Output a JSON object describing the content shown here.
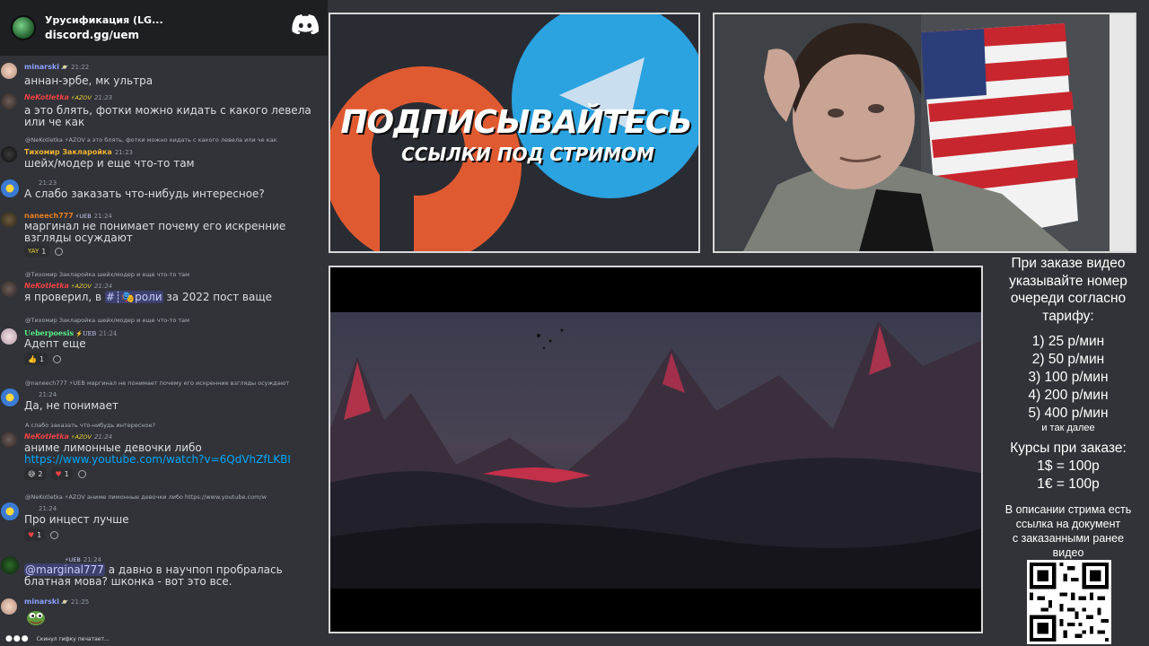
{
  "server": {
    "name": "Урусификация (LG...",
    "invite": "discord.gg/uem"
  },
  "messages": [
    {
      "user": "minarski",
      "badges": "🪐",
      "time": "21:22",
      "text": "аннан-эрбе, мк ультра",
      "color": "#8aa0ff"
    },
    {
      "user": "NeKotletka",
      "badges": "⚡AZOV",
      "time": "21:23",
      "text": "а это блять, фотки можно кидать с какого левела или че как",
      "color": "#ed4245"
    },
    {
      "reply": "@NeKotletka ⚡AZOV а это блять, фотки можно кидать с какого левела или че как",
      "user": "Тихомир Закларойка",
      "time": "21:23",
      "text": "шейх/модер и еще что-то там",
      "color": "#f0b232"
    },
    {
      "user": "",
      "time": "21:23",
      "text": "А слабо заказать что-нибудь интересное?",
      "color": "#8aa0ff"
    },
    {
      "user": "naneech777",
      "badges": "⚡UEB",
      "time": "21:24",
      "text": "маргинал не понимает почему его искренние взгляды осуждают",
      "color": "#e67e22",
      "reaction": "1"
    },
    {
      "reply": "@Тихомир Закларойка шейх/модер и еще что-то там",
      "user": "NeKotletka",
      "badges": "⚡AZOV",
      "time": "21:24",
      "text_a": "я проверил, в",
      "channel": "#┊🎭роли",
      "text_b": "за 2022 пост ваще",
      "color": "#ed4245"
    },
    {
      "reply": "@Тихомир Закларойка шейх/модер и еще что-то там",
      "user": "Ueberpoesis",
      "badges": "⚡UEB",
      "time": "21:24",
      "text": "Адепт еще",
      "color": "#57f287",
      "reaction": "1"
    },
    {
      "reply": "@naneech777 ⚡UEB маргинал не понимает почему его искренние взгляды осуждают",
      "user": "",
      "time": "21:24",
      "text": "Да, не понимает",
      "color": "#8aa0ff"
    },
    {
      "reply": "А слабо заказать что-нибудь интересное?",
      "user": "NeKotletka",
      "badges": "⚡AZOV",
      "time": "21:24",
      "text": "аниме лимонные девочки  либо",
      "link": "https://www.youtube.com/watch?v=6QdVhZfLKBI",
      "color": "#ed4245",
      "reaction": "2",
      "reaction2": "1"
    },
    {
      "reply": "@NeKotletka ⚡AZOV аниме лимонные девочки  либо https://www.youtube.com/w",
      "user": "",
      "time": "21:24",
      "text": "Про инцест лучше",
      "color": "#8aa0ff",
      "reaction": "1"
    },
    {
      "user": "",
      "badges": "⚡UEB",
      "time": "21:24",
      "mention": "@marginal777",
      "text": "а давно в научпоп пробралась блатная мова? шконка - вот это все.",
      "color": "#57f287"
    },
    {
      "user": "minarski",
      "badges": "🪐",
      "time": "21:25",
      "text": "",
      "color": "#8aa0ff"
    }
  ],
  "typing": "Скинул гифку печатает...",
  "promo": {
    "title": "ПОДПИСЫВАЙТЕСЬ",
    "subtitle": "ССЫЛКИ ПОД СТРИМОМ"
  },
  "info": {
    "header": [
      "При заказе видео",
      "указывайте номер",
      "очереди согласно",
      "тарифу:"
    ],
    "tiers": [
      "1) 25 р/мин",
      "2) 50 р/мин",
      "3) 100 р/мин",
      "4) 200 р/мин",
      "5) 400 р/мин"
    ],
    "etc": "и так далее",
    "rates_header": "Курсы при заказе:",
    "rates": [
      "1$ = 100р",
      "1€ = 100р"
    ],
    "desc": [
      "В описании стрима есть",
      "ссылка на документ",
      "с заказанными ранее",
      "видео"
    ]
  },
  "colors": {
    "discord_bg": "#313338",
    "link": "#00a8fc",
    "panel_border": "#d8d8d8"
  }
}
